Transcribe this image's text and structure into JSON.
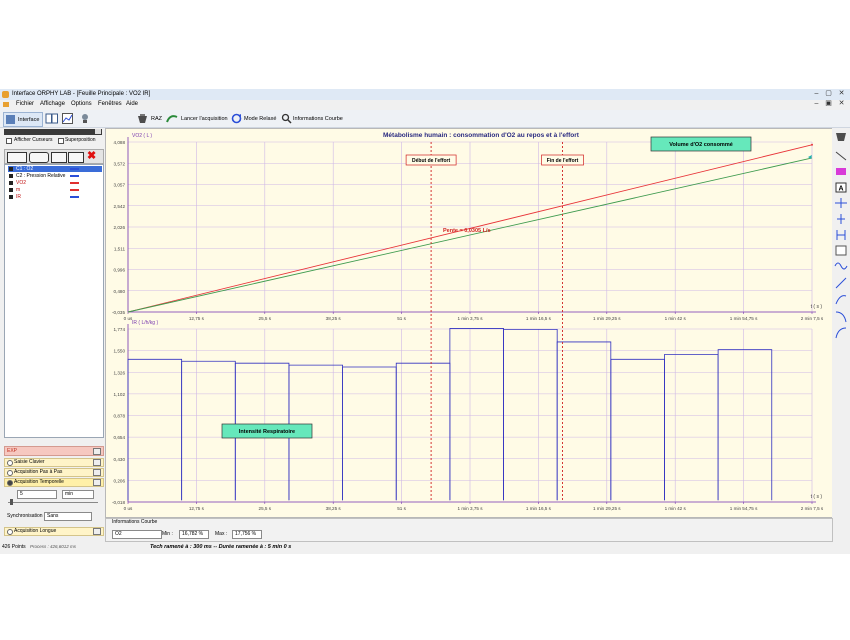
{
  "window": {
    "title": "Interface ORPHY LAB - [Feuille Principale : VO2 IR]"
  },
  "menu": [
    "Fichier",
    "Affichage",
    "Options",
    "Fenêtres",
    "Aide"
  ],
  "toolbar": {
    "interface_label": "Interface",
    "raz_label": "RAZ",
    "lancer_label": "Lancer l'acquisition",
    "relaxe_label": "Mode Relaxé",
    "info_label": "Informations Courbe"
  },
  "left_panel": {
    "afficher_curseurs": "Afficher Curseurs",
    "superposition": "Superposition",
    "curves": [
      {
        "label": "C1 : O2",
        "color": "#2b4fd8",
        "selected": true
      },
      {
        "label": "C2 : Pression Relative",
        "color": "#2b4fd8"
      },
      {
        "label": "VO2",
        "color": "#e03030"
      },
      {
        "label": "m",
        "color": "#e03030"
      },
      {
        "label": "IR",
        "color": "#2b4fd8"
      }
    ],
    "exp_label": "EXP",
    "acquisitions": {
      "saisie_clavier": "Saisie Clavier",
      "pas_a_pas": "Acquisition Pas à Pas",
      "temporelle": "Acquisition Temporelle",
      "longue": "Acquisition Longue"
    },
    "duration_value": "5",
    "duration_unit": "min",
    "sync_label": "Synchronisation",
    "sync_value": "Sans"
  },
  "chart_title": "Métabolisme humain : consommation d'O2 au repos et à l'effort",
  "annotations": {
    "debut": "Début de l'effort",
    "fin": "Fin de l'effort",
    "volume": "Volume d'O2 consommé",
    "pente": "Pente = 0,0305 L/s",
    "intensite": "Intensité Respiratoire"
  },
  "chart_data": [
    {
      "type": "line",
      "ylabel": "VO2 ( L )",
      "xlabel": "t ( s )",
      "y_ticks": [
        "4,088",
        "3,572",
        "3,057",
        "2,542",
        "2,026",
        "1,511",
        "0,996",
        "0,480",
        "-0,035"
      ],
      "x_ticks": [
        "0 us",
        "12,75 s",
        "25,5 s",
        "38,25 s",
        "51 s",
        "1 min 3,75 s",
        "1 min 16,5 s",
        "1 min 29,25 s",
        "1 min 42 s",
        "1 min 54,75 s",
        "2 min 7,5 s"
      ],
      "xlim": [
        0,
        127.5
      ],
      "ylim": [
        -0.035,
        4.088
      ],
      "series": [
        {
          "name": "VO2",
          "color": "#e8353a",
          "x": [
            0,
            127.5
          ],
          "y": [
            -0.035,
            4.02
          ]
        },
        {
          "name": "m",
          "color": "#3f9b4f",
          "x": [
            0,
            127.5
          ],
          "y": [
            -0.035,
            3.7
          ]
        }
      ],
      "markers": [
        {
          "label": "Début de l'effort",
          "x": 56.5
        },
        {
          "label": "Fin de l'effort",
          "x": 81.0
        }
      ],
      "grid": true
    },
    {
      "type": "bar",
      "ylabel": "IR ( L/h/kg )",
      "xlabel": "t ( s )",
      "y_ticks": [
        "1,774",
        "1,550",
        "1,326",
        "1,102",
        "0,878",
        "0,654",
        "0,430",
        "0,206",
        "-0,018"
      ],
      "x_ticks": [
        "0 us",
        "12,75 s",
        "25,5 s",
        "38,25 s",
        "51 s",
        "1 min 3,75 s",
        "1 min 16,5 s",
        "1 min 29,25 s",
        "1 min 42 s",
        "1 min 54,75 s",
        "2 min 7,5 s"
      ],
      "xlim": [
        0,
        127.5
      ],
      "ylim": [
        -0.018,
        1.774
      ],
      "bars": [
        {
          "x0": 0,
          "x1": 10,
          "value": 1.46
        },
        {
          "x0": 10,
          "x1": 20,
          "value": 1.44
        },
        {
          "x0": 20,
          "x1": 30,
          "value": 1.42
        },
        {
          "x0": 30,
          "x1": 40,
          "value": 1.4
        },
        {
          "x0": 40,
          "x1": 50,
          "value": 1.38
        },
        {
          "x0": 50,
          "x1": 60,
          "value": 1.42
        },
        {
          "x0": 60,
          "x1": 70,
          "value": 1.78
        },
        {
          "x0": 70,
          "x1": 80,
          "value": 1.77
        },
        {
          "x0": 80,
          "x1": 90,
          "value": 1.64
        },
        {
          "x0": 90,
          "x1": 100,
          "value": 1.46
        },
        {
          "x0": 100,
          "x1": 110,
          "value": 1.51
        },
        {
          "x0": 110,
          "x1": 120,
          "value": 1.56
        }
      ],
      "bar_color": "#3030c0",
      "grid": true
    }
  ],
  "info_panel": {
    "title": "Informations Courbe",
    "curve_value": "O2",
    "min_label": "Min :",
    "min_value": "16,782 %",
    "max_label": "Max :",
    "max_value": "17,756 %"
  },
  "status": {
    "points": "426 Points",
    "process": "Process : 426,6012 ms",
    "tech": "Tech ramené à : 300 ms -- Durée ramenée à : 5 min 0 s"
  }
}
